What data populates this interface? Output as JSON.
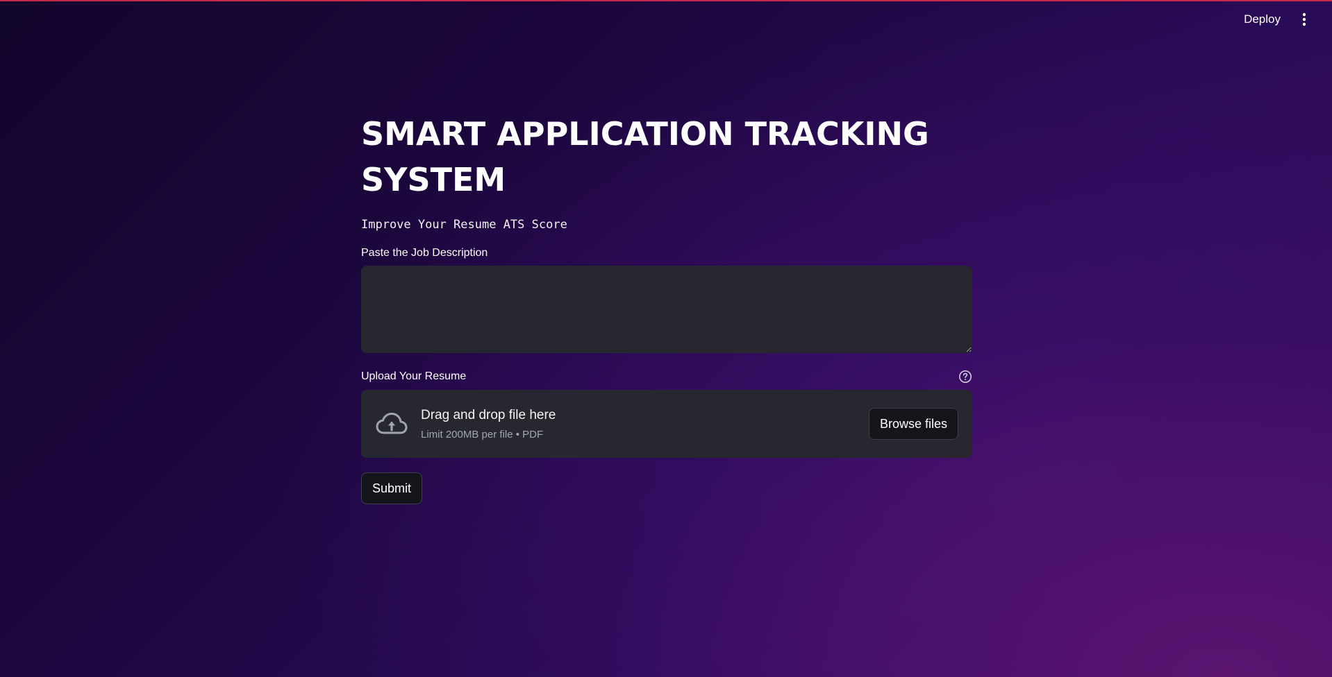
{
  "header": {
    "deploy_label": "Deploy",
    "menu_icon": "kebab-menu-icon"
  },
  "main": {
    "title": "SMART APPLICATION TRACKING SYSTEM",
    "subtitle": "Improve Your Resume ATS Score",
    "job_description": {
      "label": "Paste the Job Description",
      "value": "",
      "placeholder": ""
    },
    "resume_upload": {
      "label": "Upload Your Resume",
      "help_icon": "question-circle-icon",
      "upload_icon": "cloud-upload-icon",
      "dropzone_title": "Drag and drop file here",
      "dropzone_hint": "Limit 200MB per file • PDF",
      "browse_label": "Browse files"
    },
    "submit_label": "Submit"
  },
  "colors": {
    "accent_top_bar": "#c8284a",
    "input_background": "#26272f",
    "button_background": "#14161c"
  }
}
